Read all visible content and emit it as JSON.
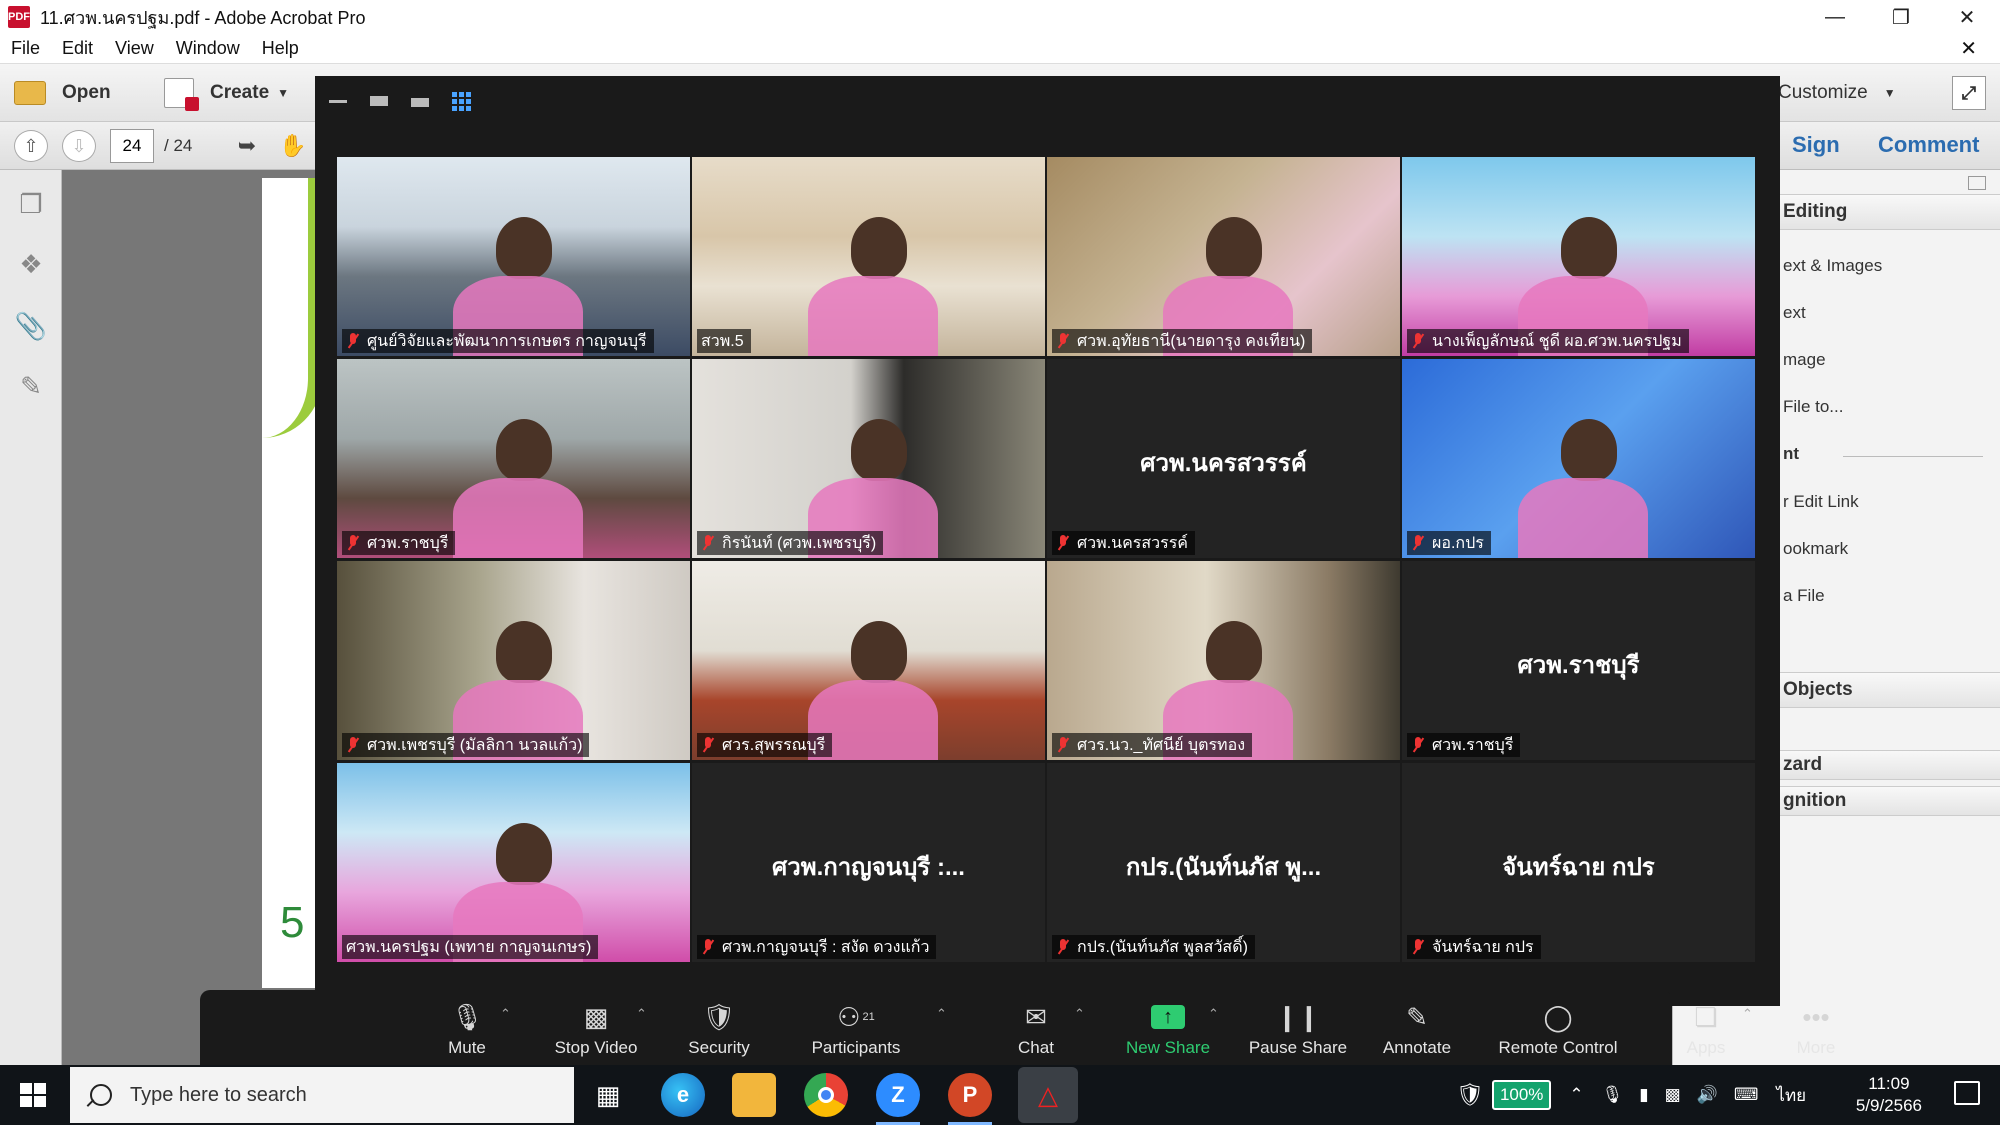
{
  "window": {
    "title": "11.ศวพ.นครปฐม.pdf - Adobe Acrobat Pro",
    "controls": [
      "minimize",
      "restore",
      "close"
    ]
  },
  "menu": {
    "items": [
      "File",
      "Edit",
      "View",
      "Window",
      "Help"
    ]
  },
  "toolbar": {
    "open_label": "Open",
    "create_label": "Create",
    "customize_label": "Customize",
    "sign_label": "Sign",
    "comment_label": "Comment"
  },
  "pager": {
    "current_page": "24",
    "total_pages": "/ 24"
  },
  "tools_panel": {
    "headers": [
      "Editing",
      "Objects",
      "zard",
      "gnition"
    ],
    "items": [
      "ext & Images",
      "ext",
      "mage",
      "File to...",
      "nt",
      "r Edit Link",
      "ookmark",
      "a File"
    ]
  },
  "document": {
    "visible_fragment": "5"
  },
  "zoom": {
    "tiles": [
      {
        "label": "ศูนย์วิจัยและพัฒนาการเกษตร กาญจนบุรี",
        "video": true,
        "scene": "sc-room1",
        "muted": true
      },
      {
        "label": "สวพ.5",
        "video": true,
        "scene": "sc-room2",
        "muted": false,
        "active": true
      },
      {
        "label": "ศวพ.อุทัยธานี(นายดารุง คงเทียน)",
        "video": true,
        "scene": "sc-office1",
        "muted": true
      },
      {
        "label": "นางเพ็ญลักษณ์ ชูดี ผอ.ศวพ.นครปฐม",
        "video": true,
        "scene": "sc-banner1",
        "muted": true
      },
      {
        "label": "ศวพ.ราชบุรี",
        "video": true,
        "scene": "sc-office2",
        "muted": true
      },
      {
        "label": "กิรนันท์ (ศวพ.เพชรบุรี)",
        "video": true,
        "scene": "sc-office3",
        "muted": true
      },
      {
        "label": "ศวพ.นครสวรรค์",
        "video": false,
        "display_name": "ศวพ.นครสวรรค์",
        "muted": true
      },
      {
        "label": "ผอ.กปร",
        "video": true,
        "scene": "sc-blue",
        "muted": true
      },
      {
        "label": "ศวพ.เพชรบุรี (มัลลิกา นวลแก้ว)",
        "video": true,
        "scene": "sc-blur",
        "muted": true
      },
      {
        "label": "ศวร.สุพรรณบุรี",
        "video": true,
        "scene": "sc-office4",
        "muted": true
      },
      {
        "label": "ศวร.นว._ทัศนีย์ บุตรทอง",
        "video": true,
        "scene": "sc-shelf",
        "muted": true
      },
      {
        "label": "ศวพ.ราชบุรี",
        "video": false,
        "display_name": "ศวพ.ราชบุรี",
        "muted": true
      },
      {
        "label": "ศวพ.นครปฐม (เพทาย กาญจนเกษร)",
        "video": true,
        "scene": "sc-banner2",
        "muted": false
      },
      {
        "label": "ศวพ.กาญจนบุรี : สงัด ดวงแก้ว",
        "video": false,
        "display_name": "ศวพ.กาญจนบุรี :...",
        "muted": true
      },
      {
        "label": "กปร.(นันท์นภัส พูลสวัสดิ์)",
        "video": false,
        "display_name": "กปร.(นันท์นภัส พู...",
        "muted": true
      },
      {
        "label": "จันทร์ฉาย  กปร",
        "video": false,
        "display_name": "จันทร์ฉาย  กปร",
        "muted": true
      }
    ],
    "controls": {
      "mute": "Mute",
      "stop_video": "Stop Video",
      "security": "Security",
      "participants": "Participants",
      "participants_count": "21",
      "chat": "Chat",
      "new_share": "New Share",
      "pause_share": "Pause Share",
      "annotate": "Annotate",
      "remote_control": "Remote Control",
      "apps": "Apps",
      "more": "More"
    }
  },
  "taskbar": {
    "search_placeholder": "Type here to search",
    "battery": "100%",
    "language": "ไทย",
    "time": "11:09",
    "date": "5/9/2566",
    "apps": [
      "task-view",
      "edge",
      "file-explorer",
      "chrome",
      "zoom",
      "powerpoint",
      "acrobat"
    ]
  },
  "colors": {
    "zoom_bg": "#1a1a1a",
    "active_speaker": "#e6e05a",
    "share_green": "#2ecc71",
    "mic_off_red": "#ee3333",
    "link_blue": "#2b6cb0"
  }
}
